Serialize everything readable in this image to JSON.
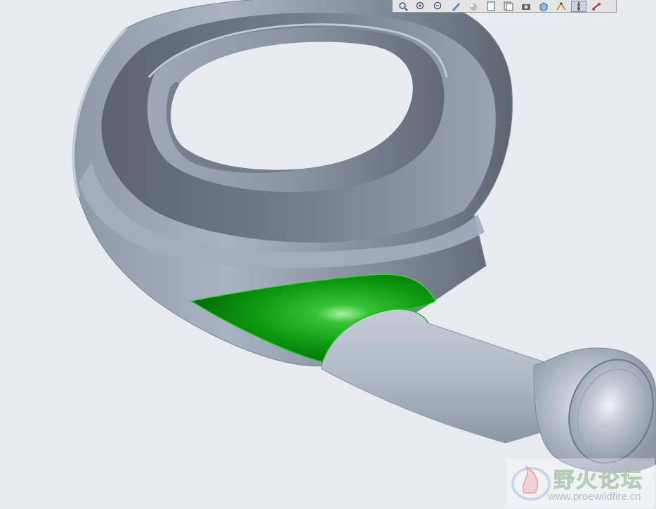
{
  "viewport": {
    "model_name": "spiral-pump-casing",
    "selected_surface": "green-highlighted-surface"
  },
  "toolbar": {
    "buttons": [
      {
        "name": "refit-icon",
        "active": false
      },
      {
        "name": "zoom-in-icon",
        "active": false
      },
      {
        "name": "zoom-out-icon",
        "active": false
      },
      {
        "name": "repaint-icon",
        "active": false
      },
      {
        "name": "spin-center-icon",
        "active": false
      },
      {
        "name": "saved-views-icon",
        "active": false
      },
      {
        "name": "layers-icon",
        "active": false
      },
      {
        "name": "appearance-icon",
        "active": false
      },
      {
        "name": "orient-icon",
        "active": false
      },
      {
        "name": "datum-planes-icon",
        "active": false
      },
      {
        "name": "datum-axes-icon",
        "active": true
      },
      {
        "name": "datum-points-icon",
        "active": false
      }
    ]
  },
  "watermark": {
    "title": "野火论坛",
    "url": "www.proewildfire.cn"
  },
  "colors": {
    "background": "#e8ebf0",
    "body_light": "#aab4c2",
    "body_dark": "#5e6674",
    "selection": "#12a012"
  }
}
